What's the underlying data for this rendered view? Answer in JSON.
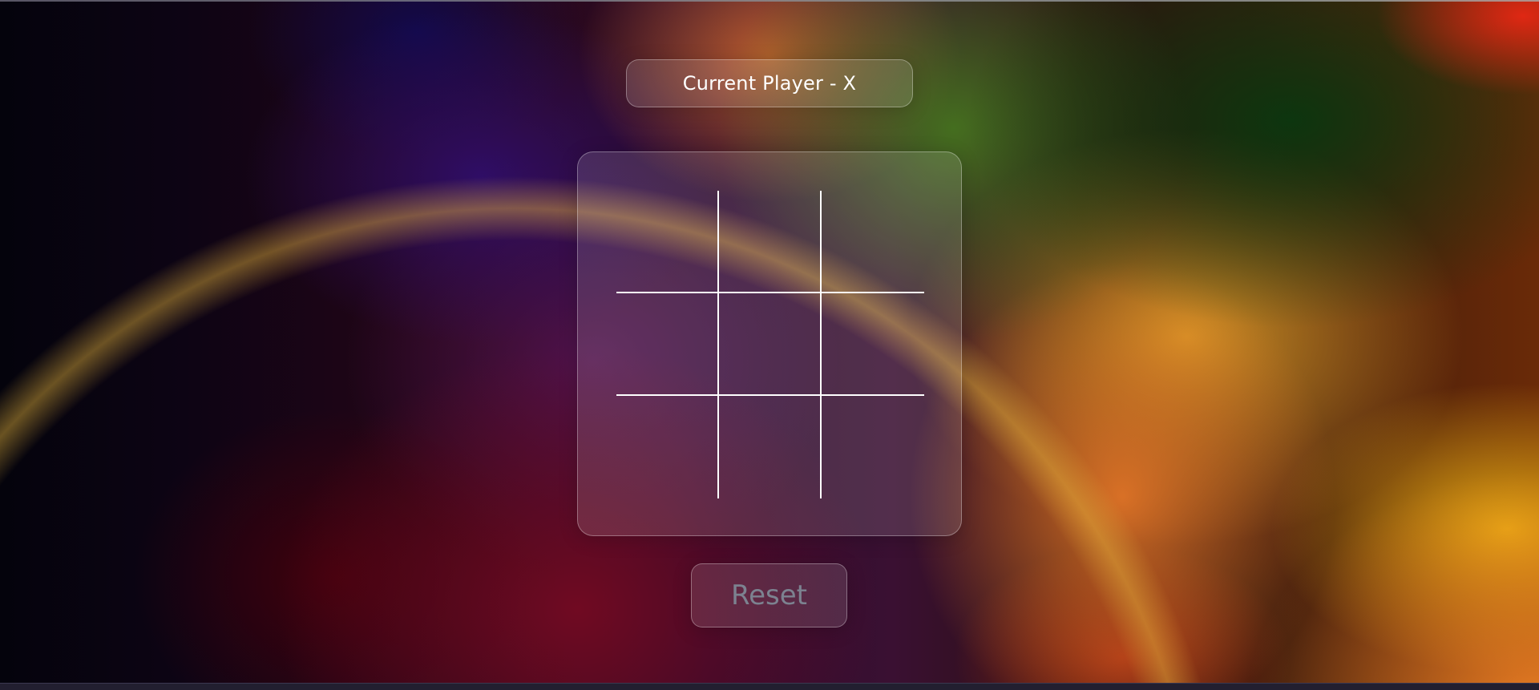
{
  "status": {
    "text": "Current Player - X"
  },
  "board": {
    "cells": [
      "",
      "",
      "",
      "",
      "",
      "",
      "",
      "",
      ""
    ]
  },
  "controls": {
    "reset_label": "Reset"
  },
  "colors": {
    "text": "#ffffff",
    "reset_text": "#7c8290",
    "grid_line": "#ffffff"
  }
}
